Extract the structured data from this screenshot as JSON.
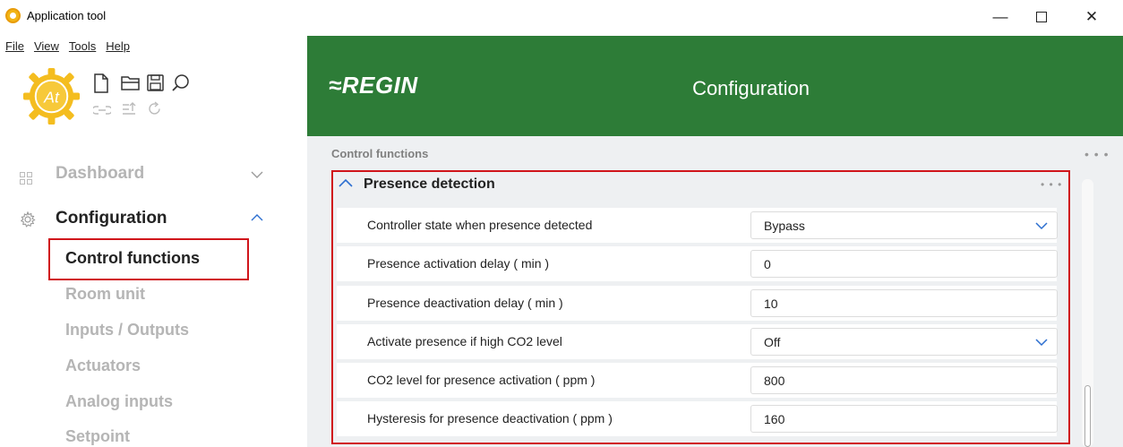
{
  "window": {
    "title": "Application tool",
    "minimize": "—",
    "close": "✕"
  },
  "menu": {
    "file": "File",
    "view": "View",
    "tools": "Tools",
    "help": "Help"
  },
  "logo_text": "At",
  "header": {
    "brand": "≈REGIN",
    "title": "Configuration"
  },
  "sidebar": {
    "dashboard": "Dashboard",
    "configuration": "Configuration",
    "sub_items": [
      "Control functions",
      "Room unit",
      "Inputs / Outputs",
      "Actuators",
      "Analog inputs",
      "Setpoint"
    ]
  },
  "content": {
    "breadcrumb": "Control functions",
    "section_title": "Presence detection",
    "rows": [
      {
        "label": "Controller state when presence detected",
        "value": "Bypass",
        "type": "dropdown"
      },
      {
        "label": "Presence activation delay ( min )",
        "value": "0",
        "type": "input"
      },
      {
        "label": "Presence deactivation delay ( min )",
        "value": "10",
        "type": "input"
      },
      {
        "label": "Activate presence if high CO2 level",
        "value": "Off",
        "type": "dropdown"
      },
      {
        "label": "CO2 level for presence activation ( ppm )",
        "value": "800",
        "type": "input"
      },
      {
        "label": "Hysteresis for presence deactivation ( ppm )",
        "value": "160",
        "type": "input"
      }
    ]
  },
  "colors": {
    "header_green": "#2d7c37",
    "highlight_red": "#d0151b",
    "accent_blue": "#2d6fd0"
  }
}
